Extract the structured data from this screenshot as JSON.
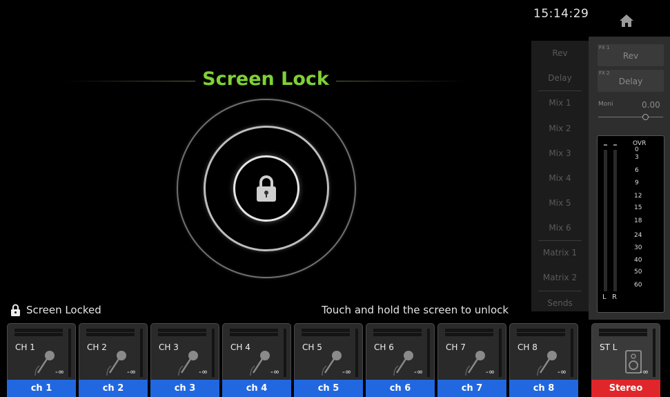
{
  "header": {
    "clock": "15:14:29",
    "home_icon": "home-icon"
  },
  "lock_screen": {
    "title": "Screen Lock",
    "status_label": "Screen Locked",
    "instruction": "Touch and hold the screen to unlock",
    "accent_color": "#7fd136"
  },
  "sends": {
    "items": [
      "Rev",
      "Delay",
      "Mix 1",
      "Mix 2",
      "Mix 3",
      "Mix 4",
      "Mix 5",
      "Mix 6",
      "Matrix 1",
      "Matrix 2",
      "Sends"
    ]
  },
  "fx": {
    "fx1_tag": "FX 1",
    "fx1_name": "Rev",
    "fx2_tag": "FX 2",
    "fx2_name": "Delay",
    "moni_label": "Moni",
    "moni_value": "0.00"
  },
  "meter": {
    "scale": [
      "OVR",
      "0",
      "3",
      "6",
      "9",
      "12",
      "15",
      "18",
      "24",
      "30",
      "40",
      "50",
      "60"
    ],
    "left": "L",
    "right": "R"
  },
  "channels": [
    {
      "label": "CH 1",
      "name": "ch 1",
      "level": "-∞"
    },
    {
      "label": "CH 2",
      "name": "ch 2",
      "level": "-∞"
    },
    {
      "label": "CH 3",
      "name": "ch 3",
      "level": "-∞"
    },
    {
      "label": "CH 4",
      "name": "ch 4",
      "level": "-∞"
    },
    {
      "label": "CH 5",
      "name": "ch 5",
      "level": "-∞"
    },
    {
      "label": "CH 6",
      "name": "ch 6",
      "level": "-∞"
    },
    {
      "label": "CH 7",
      "name": "ch 7",
      "level": "-∞"
    },
    {
      "label": "CH 8",
      "name": "ch 8",
      "level": "-∞"
    }
  ],
  "stereo": {
    "label": "ST L",
    "name": "Stereo",
    "level": "-∞",
    "color": "#e0262a"
  },
  "colors": {
    "channel_name_bg": "#2168e0",
    "background": "#000000"
  }
}
